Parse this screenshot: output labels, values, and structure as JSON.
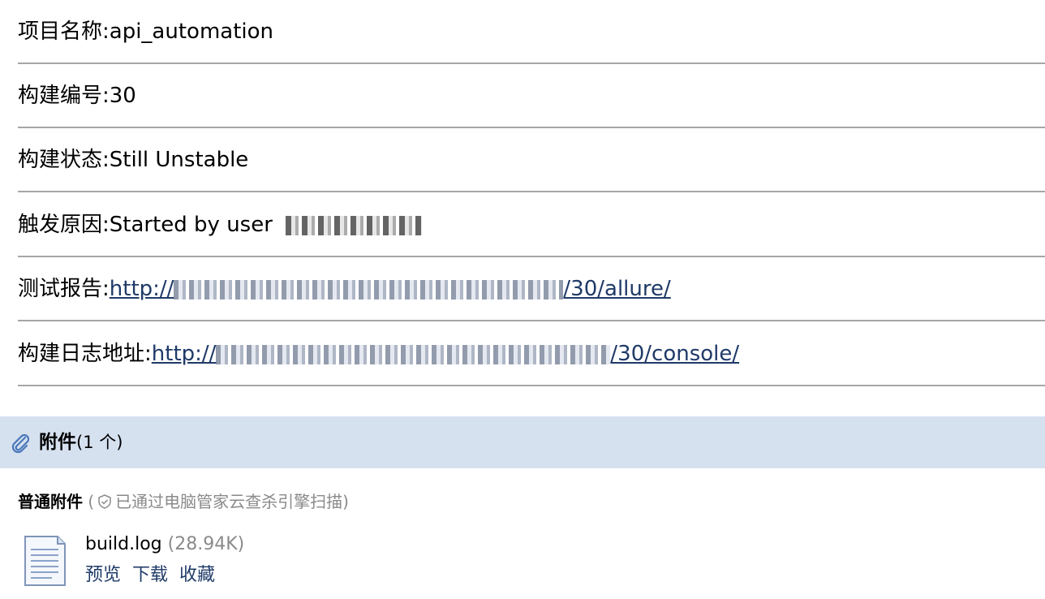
{
  "info_rows": {
    "project": {
      "label": "项目名称:",
      "value": "api_automation"
    },
    "build_number": {
      "label": "构建编号:",
      "value": "30"
    },
    "build_status": {
      "label": "构建状态:",
      "value": "Still Unstable"
    },
    "trigger_reason": {
      "label": "触发原因:",
      "value": "Started by user"
    },
    "test_report": {
      "label": "测试报告:",
      "link_prefix": "http://",
      "link_suffix": "/30/allure/"
    },
    "build_log": {
      "label": "构建日志地址:",
      "link_prefix": "http://",
      "link_suffix": "/30/console/"
    }
  },
  "attachments": {
    "title": "附件",
    "count": "(1 个)",
    "section_label": "普通附件",
    "scan_open": "(",
    "scan_text": "已通过电脑管家云查杀引擎扫描)",
    "file": {
      "name": "build.log",
      "size": "(28.94K)",
      "actions": [
        "预览",
        "下载",
        "收藏"
      ]
    }
  },
  "colors": {
    "link": "#1f3a68",
    "bar": "#d6e1f0",
    "separator": "#a6a6a6",
    "muted": "#8a8a8a"
  }
}
